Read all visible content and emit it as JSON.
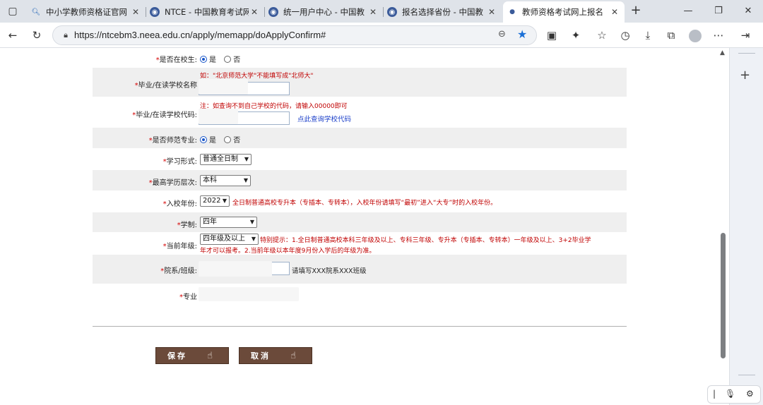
{
  "browser": {
    "tabs": [
      {
        "title": "中小学教师资格证官网",
        "close": "✕"
      },
      {
        "title": "NTCE - 中国教育考试网",
        "close": "✕"
      },
      {
        "title": "统一用户中心 - 中国教",
        "close": "✕"
      },
      {
        "title": "报名选择省份 - 中国教",
        "close": "✕"
      },
      {
        "title": "教师资格考试网上报名",
        "close": "✕"
      }
    ],
    "url": "https://ntcebm3.neea.edu.cn/apply/memapp/doApplyConfirm#"
  },
  "form": {
    "in_school": {
      "label": "是否在校生:",
      "yes": "是",
      "no": "否",
      "selected": "是"
    },
    "school_name": {
      "label": "毕业/在读学校名称",
      "hint": "如：\"北京师范大学\"不能填写成\"北师大\""
    },
    "school_code": {
      "label": "毕业/在读学校代码:",
      "hint": "如查询不到自己学校的代码，请输入00000即可",
      "hint_prefix": "注：",
      "link": "点此查询学校代码"
    },
    "normal_major": {
      "label": "是否师范专业:",
      "yes": "是",
      "no": "否",
      "selected": "是"
    },
    "study_form": {
      "label": "学习形式:",
      "value": "普通全日制"
    },
    "education_level": {
      "label": "最高学历层次:",
      "value": "本科"
    },
    "entry_year": {
      "label": "入校年份:",
      "value": "2022",
      "hint": "全日制普通高校专升本（专插本、专转本），入校年份请填写“最初”进入“大专”时的入校年份。"
    },
    "schooling_length": {
      "label": "学制:",
      "value": "四年"
    },
    "current_grade": {
      "label": "当前年级:",
      "value": "四年级及以上",
      "hint_line1": "特别提示：1.全日制普通高校本科三年级及以上、专科三年级、专升本（专插本、专转本）一年级及以上、3+2毕业学",
      "hint_line2": "年才可以报考。2.当前年级以本年度9月份入学后的年级为准。"
    },
    "department_class": {
      "label": "院系/班级:",
      "note": "请填写XXX院系XXX班级"
    },
    "major": {
      "label": "专业"
    },
    "required_mark": "*"
  },
  "buttons": {
    "save": "保存",
    "cancel": "取消"
  }
}
